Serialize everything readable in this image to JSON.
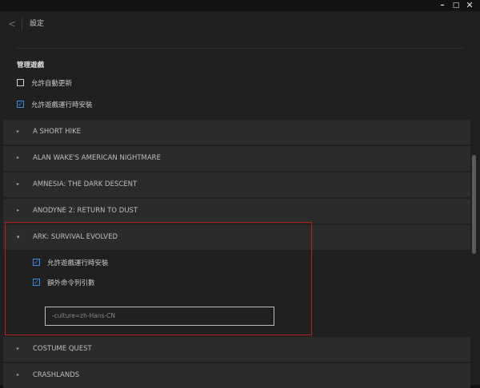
{
  "window": {
    "minimize_glyph": "–",
    "maximize_glyph": "□",
    "close_glyph": "✕"
  },
  "topbar": {
    "back_glyph": "<",
    "title": "設定"
  },
  "manage_games": {
    "title": "管理遊戲",
    "options": [
      {
        "label": "允許自動更新",
        "checked": false
      },
      {
        "label": "允許遊戲運行時安裝",
        "checked": true
      }
    ]
  },
  "games": [
    {
      "name": "A SHORT HIKE",
      "expanded": false
    },
    {
      "name": "ALAN WAKE'S AMERICAN NIGHTMARE",
      "expanded": false
    },
    {
      "name": "AMNESIA: THE DARK DESCENT",
      "expanded": false
    },
    {
      "name": "ANODYNE 2: RETURN TO DUST",
      "expanded": false
    },
    {
      "name": "ARK: SURVIVAL EVOLVED",
      "expanded": true
    },
    {
      "name": "COSTUME QUEST",
      "expanded": false
    },
    {
      "name": "CRASHLANDS",
      "expanded": false
    }
  ],
  "ark_settings": {
    "options": [
      {
        "label": "允許遊戲運行時安裝",
        "checked": true
      },
      {
        "label": "額外命令列引數",
        "checked": true
      }
    ],
    "launch_args_value": "-culture=zh-Hans-CN"
  },
  "glyphs": {
    "caret_collapsed": "▸",
    "caret_expanded": "▾",
    "check": "✓"
  },
  "colors": {
    "accent": "#3a8ee6",
    "highlight": "#b3231f"
  }
}
